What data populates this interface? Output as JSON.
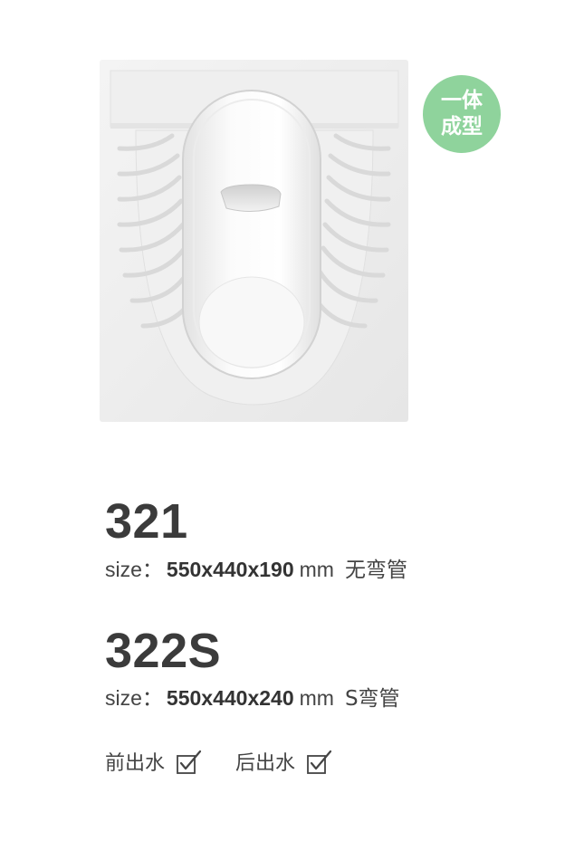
{
  "badge": {
    "line1": "一体",
    "line2": "成型",
    "color": "#8fd39c"
  },
  "product_image": {
    "icon": "squat-toilet-image"
  },
  "products": [
    {
      "model": "321",
      "size_label": "size",
      "size_colon": "：",
      "size_value": "550x440x190",
      "unit": "mm",
      "note": "无弯管"
    },
    {
      "model": "322S",
      "size_label": "size",
      "size_colon": "：",
      "size_value": "550x440x240",
      "unit": "mm",
      "note": "S弯管"
    }
  ],
  "outlets": [
    {
      "label": "前出水",
      "checked": true
    },
    {
      "label": "后出水",
      "checked": true
    }
  ]
}
